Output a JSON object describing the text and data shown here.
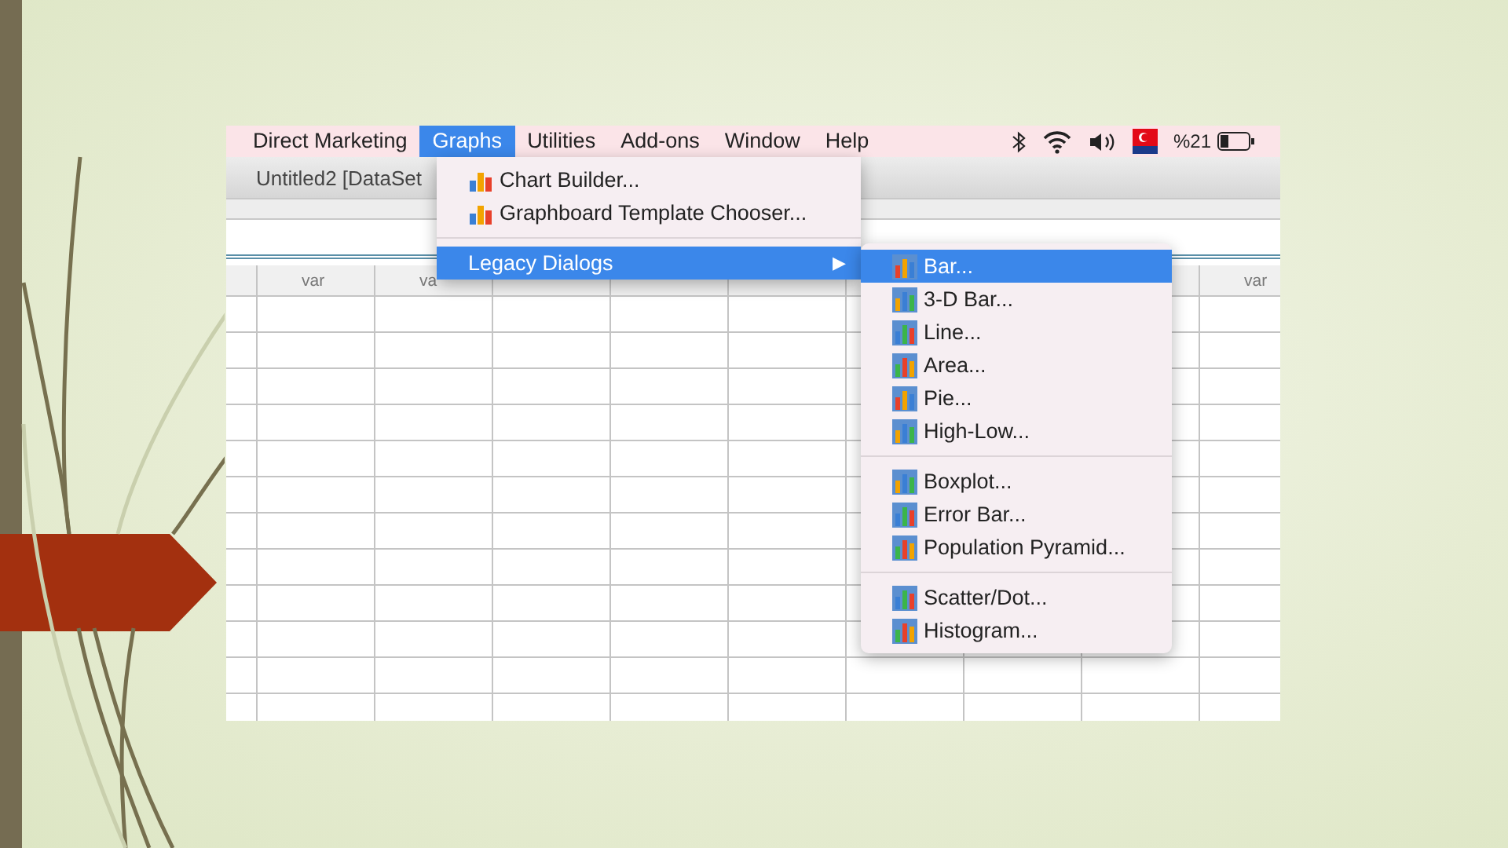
{
  "menubar": {
    "items": [
      {
        "label": "Direct Marketing",
        "selected": false
      },
      {
        "label": "Graphs",
        "selected": true
      },
      {
        "label": "Utilities",
        "selected": false
      },
      {
        "label": "Add-ons",
        "selected": false
      },
      {
        "label": "Window",
        "selected": false
      },
      {
        "label": "Help",
        "selected": false
      }
    ],
    "battery_text": "%21"
  },
  "document": {
    "title": "Untitled2 [DataSet"
  },
  "grid": {
    "columns": [
      {
        "label": "var"
      },
      {
        "label": "va"
      },
      {},
      {},
      {},
      {},
      {},
      {},
      {
        "label": "var"
      }
    ]
  },
  "graphs_menu": {
    "groups": [
      [
        {
          "label": "Chart Builder...",
          "selected": false
        },
        {
          "label": "Graphboard Template Chooser...",
          "selected": false
        }
      ],
      [
        {
          "label": "Legacy Dialogs",
          "selected": true,
          "arrow": "▶"
        }
      ]
    ]
  },
  "legacy_submenu": {
    "groups": [
      [
        {
          "label": "Bar...",
          "selected": true
        },
        {
          "label": "3-D Bar...",
          "selected": false
        },
        {
          "label": "Line...",
          "selected": false
        },
        {
          "label": "Area...",
          "selected": false
        },
        {
          "label": "Pie...",
          "selected": false
        },
        {
          "label": "High-Low...",
          "selected": false
        }
      ],
      [
        {
          "label": "Boxplot...",
          "selected": false
        },
        {
          "label": "Error Bar...",
          "selected": false
        },
        {
          "label": "Population Pyramid...",
          "selected": false
        }
      ],
      [
        {
          "label": "Scatter/Dot...",
          "selected": false
        },
        {
          "label": "Histogram...",
          "selected": false
        }
      ]
    ]
  }
}
